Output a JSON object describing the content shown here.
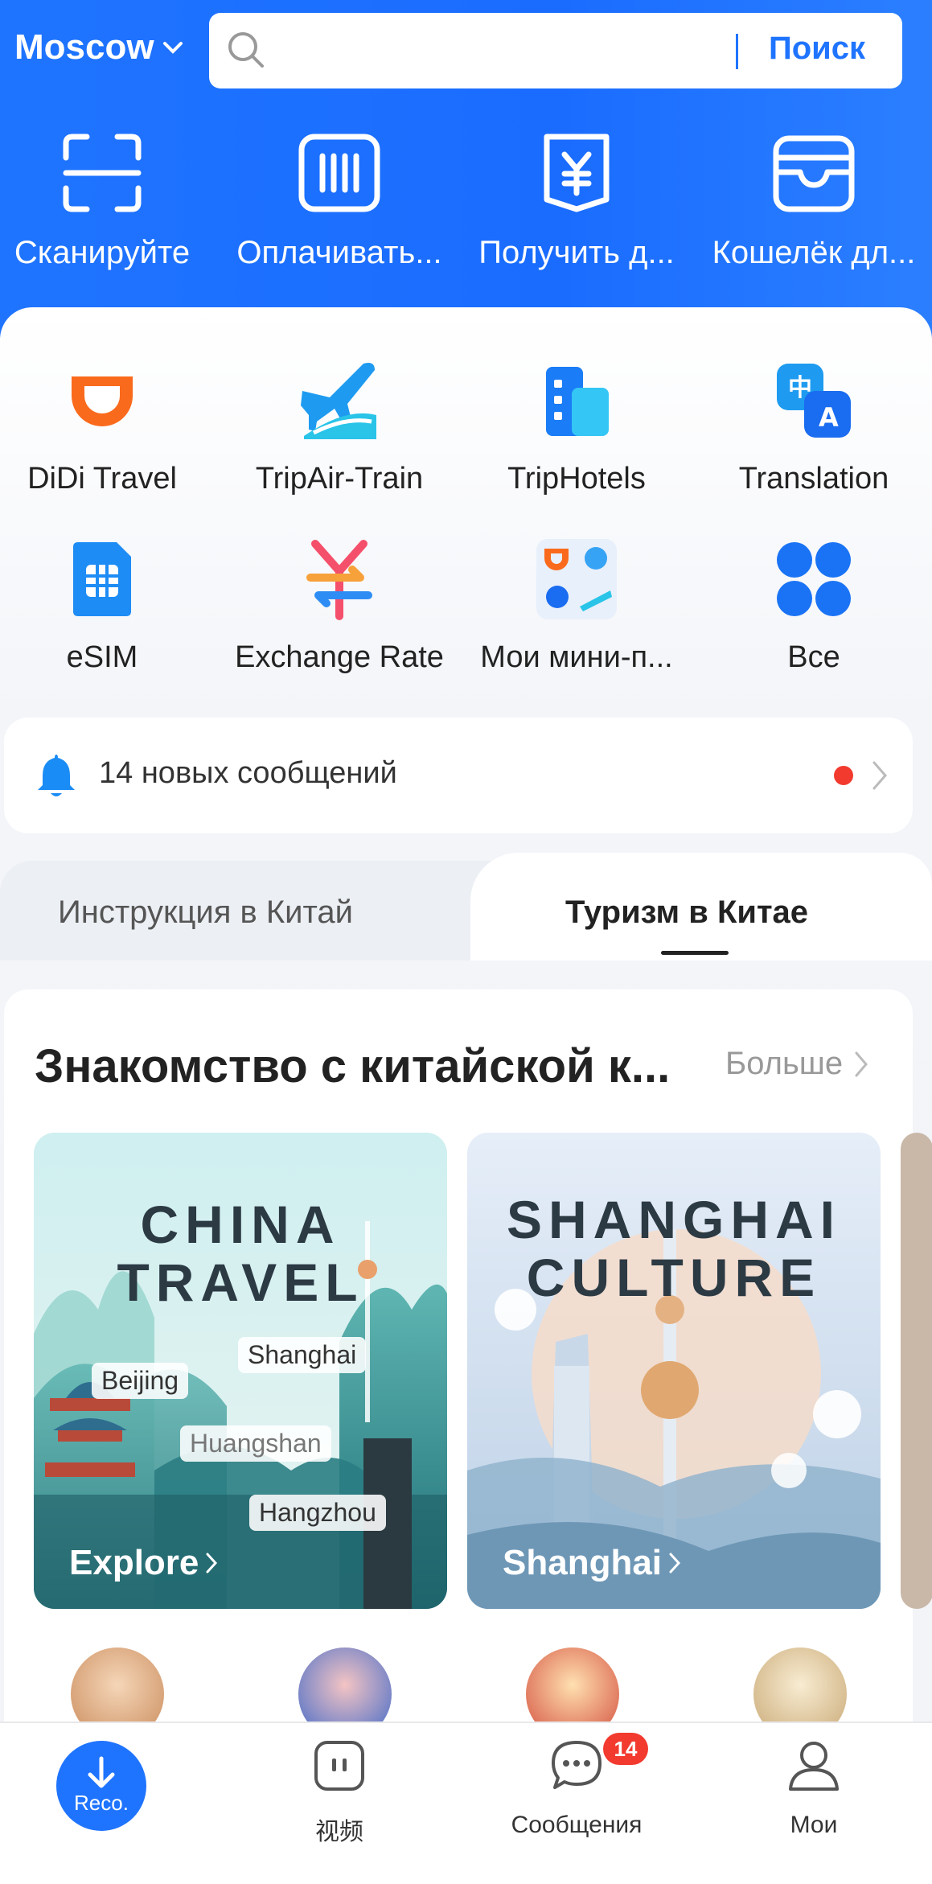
{
  "header": {
    "city": "Moscow",
    "search_button": "Поиск",
    "quick_actions": [
      {
        "label": "Сканируйте",
        "icon": "scan-icon"
      },
      {
        "label": "Оплачивать...",
        "icon": "pay-barcode-icon"
      },
      {
        "label": "Получить д...",
        "icon": "receive-yuan-icon"
      },
      {
        "label": "Кошелёк дл...",
        "icon": "wallet-icon"
      }
    ]
  },
  "apps": [
    {
      "label": "DiDi Travel",
      "icon": "didi-icon"
    },
    {
      "label": "TripAir-Train",
      "icon": "plane-train-icon"
    },
    {
      "label": "TripHotels",
      "icon": "hotel-icon"
    },
    {
      "label": "Translation",
      "icon": "translate-icon"
    },
    {
      "label": "eSIM",
      "icon": "esim-icon"
    },
    {
      "label": "Exchange Rate",
      "icon": "exchange-icon"
    },
    {
      "label": "Мои мини-п...",
      "icon": "mini-programs-icon"
    },
    {
      "label": "Все",
      "icon": "all-apps-icon"
    }
  ],
  "notification": {
    "text": "14 новых сообщений"
  },
  "tabs": {
    "left": "Инструкция в Китай",
    "right": "Туризм в Китае"
  },
  "section": {
    "title": "Знакомство с китайской к...",
    "more": "Больше",
    "banners": [
      {
        "title_line1": "CHINA",
        "title_line2": "TRAVEL",
        "cta": "Explore",
        "tags": [
          "Shanghai",
          "Beijing",
          "Huangshan",
          "Hangzhou"
        ]
      },
      {
        "title_line1": "SHANGHAI",
        "title_line2": "CULTURE",
        "cta": "Shanghai"
      }
    ]
  },
  "bottom_nav": {
    "reco": "Reco.",
    "video": "视频",
    "messages": "Сообщения",
    "messages_badge": "14",
    "mine": "Мои"
  },
  "colors": {
    "brand_blue": "#1f74ff",
    "badge_red": "#f23a2e",
    "didi_orange": "#fa6a1c"
  }
}
